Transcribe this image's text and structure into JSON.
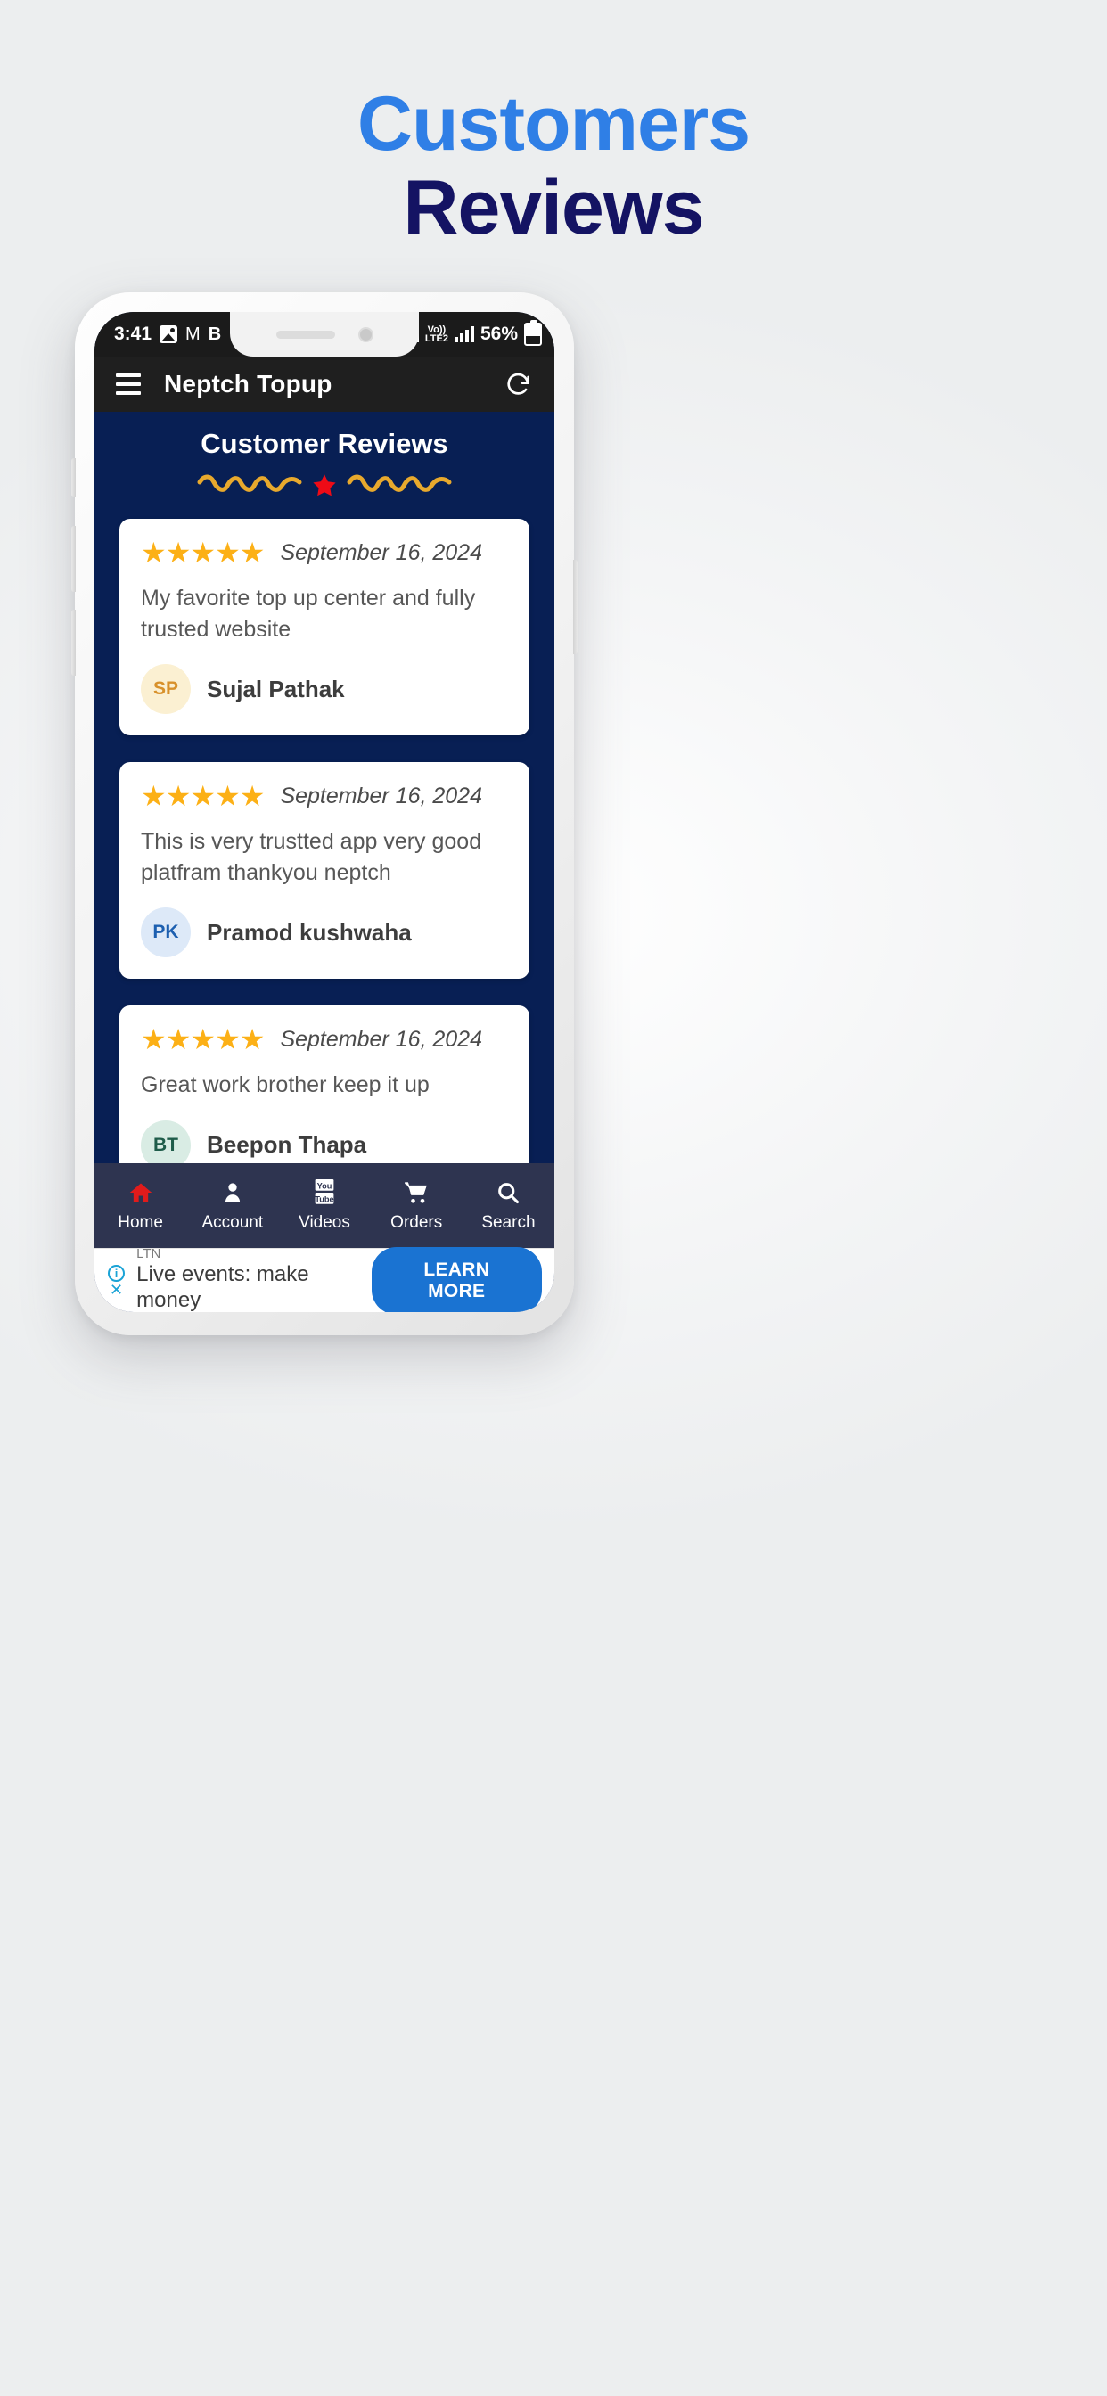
{
  "heading": {
    "line1": "Customers",
    "line2": "Reviews",
    "color_blue": "#2f7fe6",
    "color_navy": "#141363"
  },
  "phone": {
    "status_bar": {
      "time": "3:41",
      "icons": [
        "photos-icon",
        "gmail-icon",
        "b-app-icon"
      ],
      "network_label": "Vo)) LTE2",
      "volte_top": "Vo))",
      "volte_bottom": "LTE2",
      "battery_percent": "56%"
    },
    "app_bar": {
      "menu_icon": "hamburger-icon",
      "title": "Neptch Topup",
      "refresh_icon": "refresh-icon"
    },
    "section": {
      "title": "Customer Reviews",
      "decoration": "wavy-line-star-divider",
      "wave_color": "#e8a92d",
      "star_color": "#ef0b16"
    },
    "reviews": [
      {
        "stars": "★★★★★",
        "rating": 5,
        "date": "September 16, 2024",
        "text": "My favorite top up center and fully trusted website",
        "author": "Sujal Pathak",
        "initials": "SP",
        "avatar_bg": "#fbf0d2",
        "avatar_fg": "#d8912b"
      },
      {
        "stars": "★★★★★",
        "rating": 5,
        "date": "September 16, 2024",
        "text": "This is very trustted app very good platfram thankyou neptch",
        "author": "Pramod kushwaha",
        "initials": "PK",
        "avatar_bg": "#dde9f8",
        "avatar_fg": "#1c5fb0"
      },
      {
        "stars": "★★★★★",
        "rating": 5,
        "date": "September 16, 2024",
        "text": "Great work brother keep it up",
        "author": "Beepon Thapa",
        "initials": "BT",
        "avatar_bg": "#d9ece4",
        "avatar_fg": "#1f5c4a"
      }
    ],
    "bottom_nav": {
      "background": "#2e3450",
      "active_color": "#e01b1b",
      "items": [
        {
          "label": "Home",
          "icon": "home-icon",
          "active": true
        },
        {
          "label": "Account",
          "icon": "person-icon",
          "active": false
        },
        {
          "label": "Videos",
          "icon": "youtube-icon",
          "active": false
        },
        {
          "label": "Orders",
          "icon": "cart-icon",
          "active": false
        },
        {
          "label": "Search",
          "icon": "search-icon",
          "active": false
        }
      ]
    },
    "ad": {
      "info_icon": "info-icon",
      "close_icon": "close-icon",
      "source": "LTN",
      "text": "Live events: make money",
      "cta": "LEARN MORE",
      "cta_color": "#1a73d2"
    }
  }
}
